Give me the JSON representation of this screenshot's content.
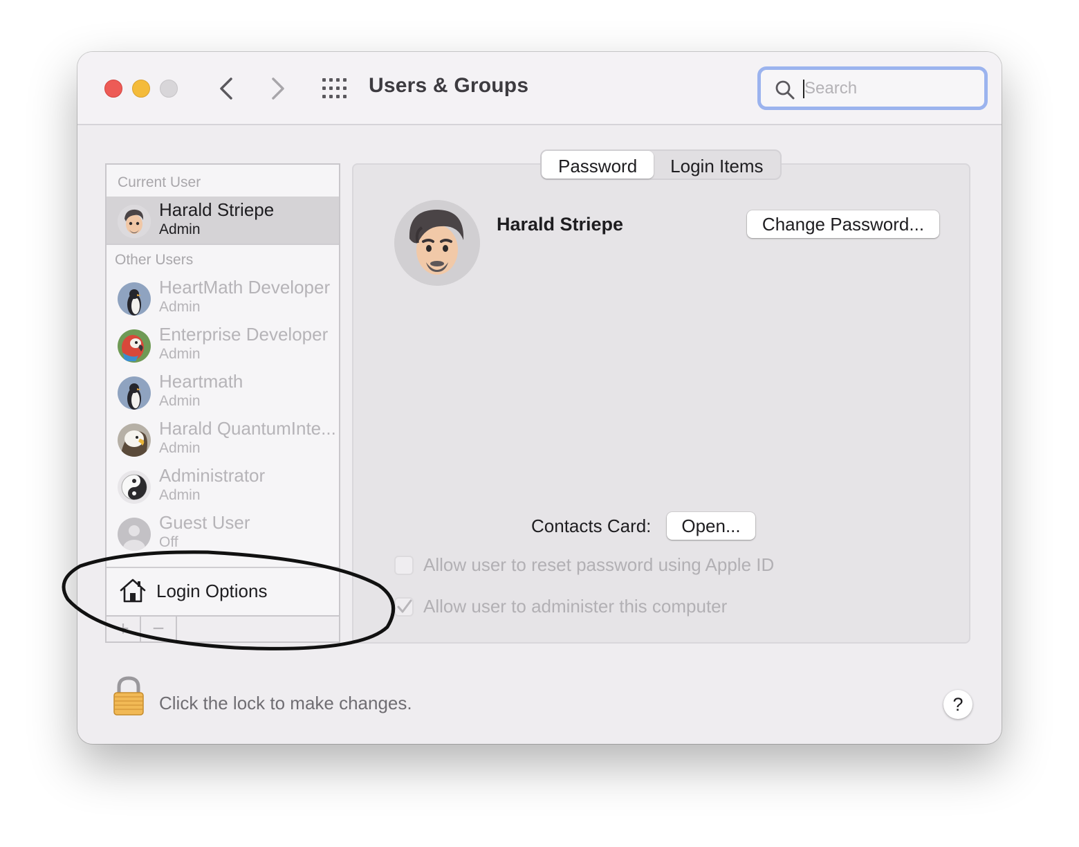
{
  "window": {
    "title": "Users & Groups"
  },
  "toolbar": {
    "back_icon": "chevron-left-icon",
    "forward_icon": "chevron-right-icon",
    "grid_icon": "grid-icon"
  },
  "search": {
    "placeholder": "Search",
    "value": ""
  },
  "sidebar": {
    "current_header": "Current User",
    "current_user": {
      "name": "Harald Striepe",
      "role": "Admin",
      "avatar": "memoji-avatar"
    },
    "other_header": "Other Users",
    "other_users": [
      {
        "name": "HeartMath Developer",
        "role": "Admin",
        "avatar": "penguin-avatar"
      },
      {
        "name": "Enterprise Developer",
        "role": "Admin",
        "avatar": "parrot-avatar"
      },
      {
        "name": "Heartmath",
        "role": "Admin",
        "avatar": "penguin-avatar"
      },
      {
        "name": "Harald QuantumInte...",
        "role": "Admin",
        "avatar": "eagle-avatar"
      },
      {
        "name": "Administrator",
        "role": "Admin",
        "avatar": "yin-yang-avatar"
      },
      {
        "name": "Guest User",
        "role": "Off",
        "avatar": "guest-avatar"
      }
    ],
    "login_options": "Login Options",
    "add_label": "+",
    "remove_label": "−"
  },
  "tabs": [
    {
      "label": "Password",
      "active": true
    },
    {
      "label": "Login Items",
      "active": false
    }
  ],
  "detail": {
    "user_name": "Harald Striepe",
    "change_password": "Change Password...",
    "contacts_label": "Contacts Card:",
    "open_button": "Open...",
    "allow_reset": {
      "label": "Allow user to reset password using Apple ID",
      "checked": false
    },
    "allow_admin": {
      "label": "Allow user to administer this computer",
      "checked": true
    }
  },
  "footer": {
    "lock_text": "Click the lock to make changes.",
    "help_label": "?"
  },
  "colors": {
    "close": "#ed5b56",
    "minimize": "#f4bb3a",
    "zoom": "#d8d6d9",
    "search_focus": "#9bb3ee",
    "annotation": "#111111"
  }
}
